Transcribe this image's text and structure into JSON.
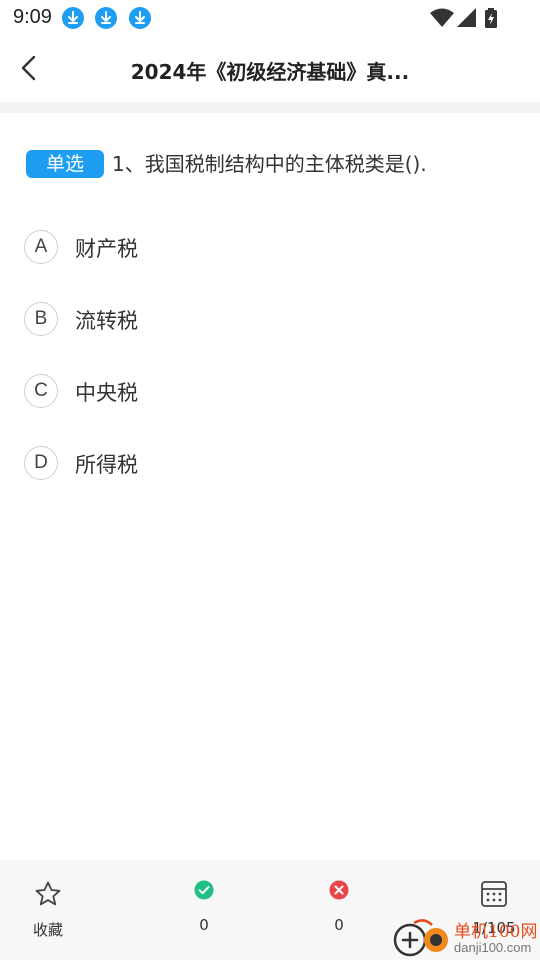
{
  "status_bar": {
    "time": "9:09",
    "icons": [
      "download-icon",
      "download-icon",
      "download-icon",
      "wifi-icon",
      "signal-icon",
      "battery-charging-icon"
    ]
  },
  "header": {
    "back_icon": "chevron-left-icon",
    "title": "2024年《初级经济基础》真..."
  },
  "question": {
    "type_badge": "单选",
    "text": "1、我国税制结构中的主体税类是()."
  },
  "options": [
    {
      "letter": "A",
      "text": "财产税"
    },
    {
      "letter": "B",
      "text": "流转税"
    },
    {
      "letter": "C",
      "text": "中央税"
    },
    {
      "letter": "D",
      "text": "所得税"
    }
  ],
  "bottom_bar": {
    "favorite_label": "收藏",
    "correct_count": "0",
    "wrong_count": "0",
    "progress": "1/105"
  },
  "watermark": {
    "text_cn": "单机100网",
    "text_en": "danji100.com"
  },
  "colors": {
    "accent": "#1e9ef2",
    "correct": "#1fbf85",
    "wrong": "#e9454b",
    "watermark": "#e84b1b"
  }
}
